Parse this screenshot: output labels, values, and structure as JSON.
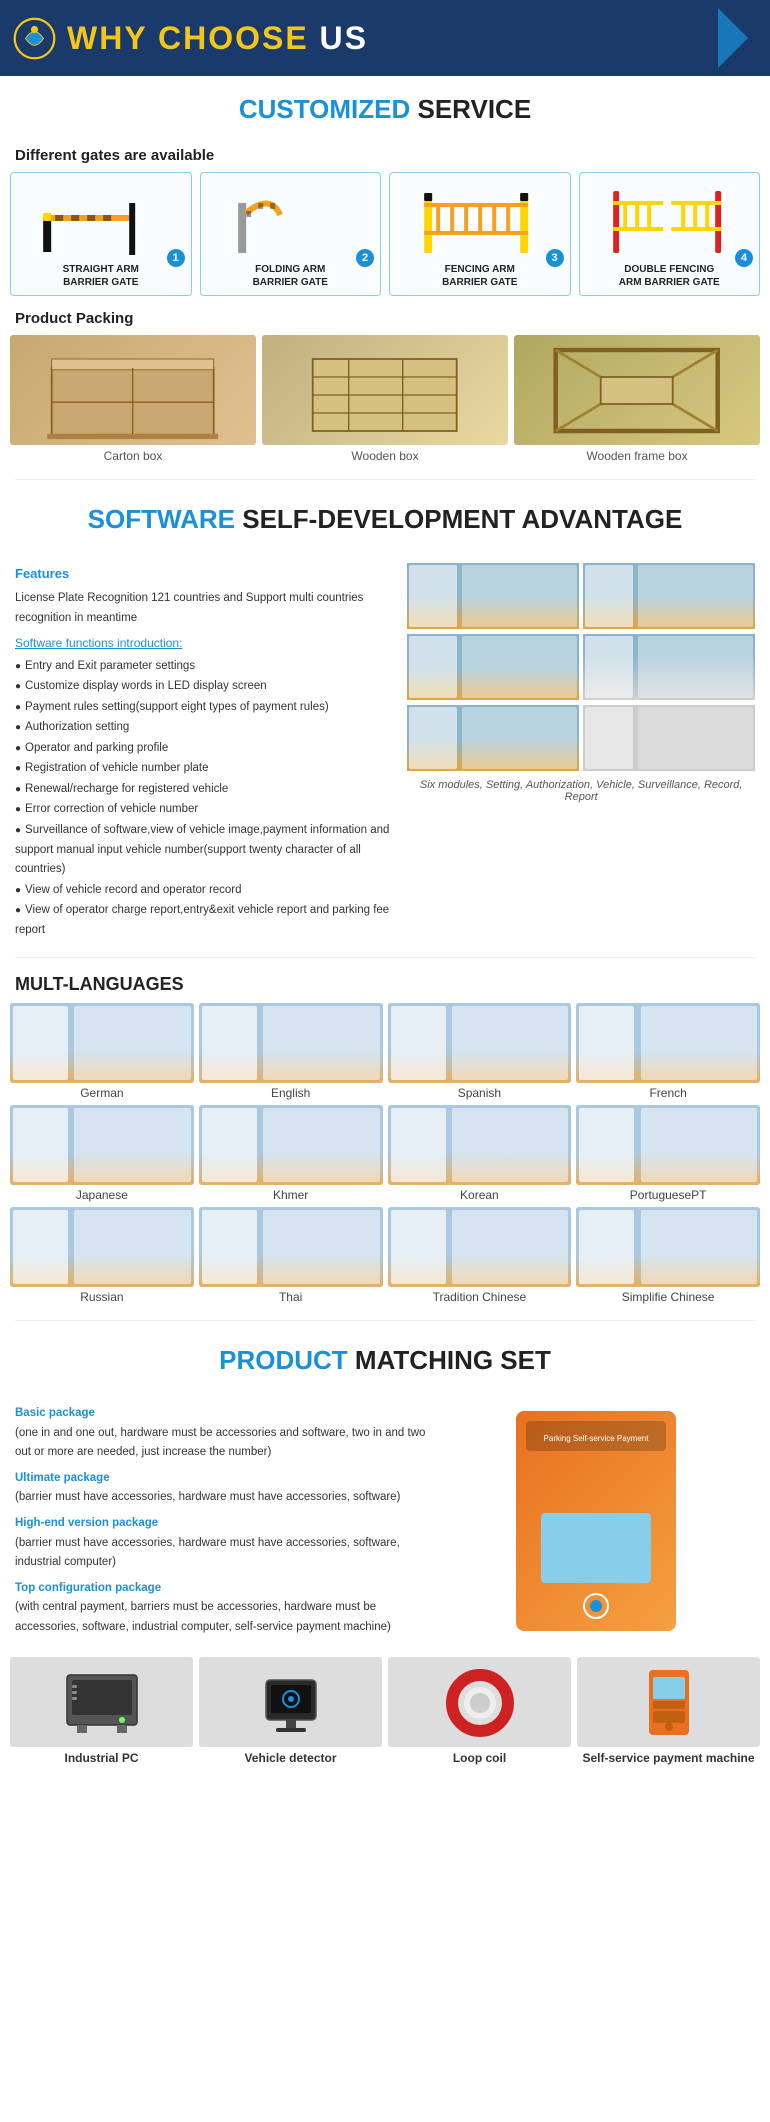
{
  "header": {
    "title1": "WHY CHOOSE",
    "title2": "US",
    "logo_alt": "logo"
  },
  "customized": {
    "section_title1": "CUSTOMIZED",
    "section_title2": "SERVICE",
    "gates_heading": "Different gates are available",
    "gates": [
      {
        "num": "1",
        "label": "STRAIGHT ARM\nBARRIER GATE"
      },
      {
        "num": "2",
        "label": "FOLDING ARM\nBARRIER GATE"
      },
      {
        "num": "3",
        "label": "FENCING ARM\nBARRIER GATE"
      },
      {
        "num": "4",
        "label": "DOUBLE FENCING\nARM BARRIER GATE"
      }
    ],
    "packing_heading": "Product Packing",
    "packing": [
      {
        "label": "Carton box"
      },
      {
        "label": "Wooden box"
      },
      {
        "label": "Wooden frame box"
      }
    ]
  },
  "software": {
    "section_title1": "SOFTWARE",
    "section_title2": "SELF-DEVELOPMENT\nADVANTAGE",
    "features_title": "Features",
    "features_desc": "License Plate Recognition 121 countries and Support multi countries recognition in meantime",
    "intro_title": "Software functions introduction:",
    "functions": [
      "Entry and Exit parameter settings",
      "Customize display words in LED display screen",
      "Payment rules setting(support eight types of payment rules)",
      "Authorization setting",
      "Operator and parking profile",
      "Registration of vehicle number plate",
      "Renewal/recharge for registered vehicle",
      "Error correction of vehicle number",
      "Surveillance of software,view of vehicle image,payment information and support manual input vehicle number(support twenty character of all countries)",
      "View of vehicle record and operator record",
      "View of operator charge report,entry&exit vehicle report and parking fee report"
    ],
    "caption": "Six modules, Setting, Authorization, Vehicle, Surveillance, Record, Report"
  },
  "languages": {
    "title": "MULT-LANGUAGES",
    "items": [
      "German",
      "English",
      "Spanish",
      "French",
      "Japanese",
      "Khmer",
      "Korean",
      "PortuguesePT",
      "Russian",
      "Thai",
      "Tradition Chinese",
      "Simplifie Chinese"
    ]
  },
  "product": {
    "section_title1": "PRODUCT",
    "section_title2": "MATCHING SET",
    "packages": [
      {
        "title": "Basic package",
        "desc": "(one in and one out, hardware must be accessories and software, two in and two out or more are needed, just increase the number)"
      },
      {
        "title": "Ultimate package",
        "desc": "(barrier must have accessories, hardware must have accessories, software)"
      },
      {
        "title": "High-end version package",
        "desc": "(barrier must have accessories, hardware must have accessories, software, industrial computer)"
      },
      {
        "title": "Top configuration package",
        "desc": "(with central payment, barriers must be accessories, hardware must be accessories, software, industrial computer, self-service payment machine)"
      }
    ],
    "machine_label": "Parking Self-service Payment"
  },
  "bottom": {
    "items": [
      {
        "label": "Industrial PC"
      },
      {
        "label": "Vehicle detector"
      },
      {
        "label": "Loop coil"
      },
      {
        "label": "Self-service payment machine"
      }
    ]
  }
}
